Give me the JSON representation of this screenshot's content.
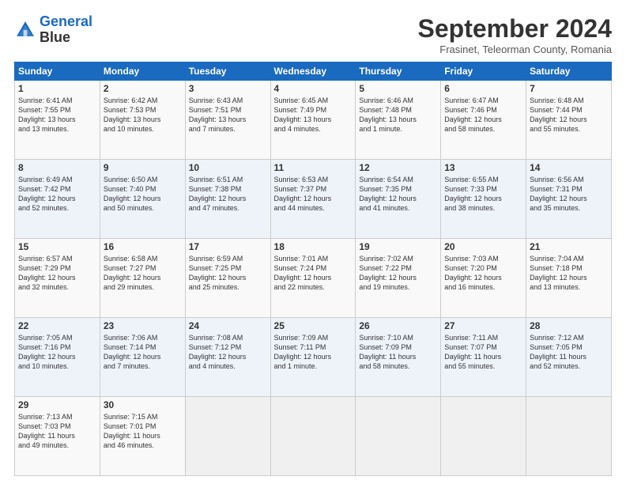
{
  "header": {
    "logo_line1": "General",
    "logo_line2": "Blue",
    "month_title": "September 2024",
    "location": "Frasinet, Teleorman County, Romania"
  },
  "weekdays": [
    "Sunday",
    "Monday",
    "Tuesday",
    "Wednesday",
    "Thursday",
    "Friday",
    "Saturday"
  ],
  "weeks": [
    [
      {
        "day": "1",
        "lines": [
          "Sunrise: 6:41 AM",
          "Sunset: 7:55 PM",
          "Daylight: 13 hours",
          "and 13 minutes."
        ]
      },
      {
        "day": "2",
        "lines": [
          "Sunrise: 6:42 AM",
          "Sunset: 7:53 PM",
          "Daylight: 13 hours",
          "and 10 minutes."
        ]
      },
      {
        "day": "3",
        "lines": [
          "Sunrise: 6:43 AM",
          "Sunset: 7:51 PM",
          "Daylight: 13 hours",
          "and 7 minutes."
        ]
      },
      {
        "day": "4",
        "lines": [
          "Sunrise: 6:45 AM",
          "Sunset: 7:49 PM",
          "Daylight: 13 hours",
          "and 4 minutes."
        ]
      },
      {
        "day": "5",
        "lines": [
          "Sunrise: 6:46 AM",
          "Sunset: 7:48 PM",
          "Daylight: 13 hours",
          "and 1 minute."
        ]
      },
      {
        "day": "6",
        "lines": [
          "Sunrise: 6:47 AM",
          "Sunset: 7:46 PM",
          "Daylight: 12 hours",
          "and 58 minutes."
        ]
      },
      {
        "day": "7",
        "lines": [
          "Sunrise: 6:48 AM",
          "Sunset: 7:44 PM",
          "Daylight: 12 hours",
          "and 55 minutes."
        ]
      }
    ],
    [
      {
        "day": "8",
        "lines": [
          "Sunrise: 6:49 AM",
          "Sunset: 7:42 PM",
          "Daylight: 12 hours",
          "and 52 minutes."
        ]
      },
      {
        "day": "9",
        "lines": [
          "Sunrise: 6:50 AM",
          "Sunset: 7:40 PM",
          "Daylight: 12 hours",
          "and 50 minutes."
        ]
      },
      {
        "day": "10",
        "lines": [
          "Sunrise: 6:51 AM",
          "Sunset: 7:38 PM",
          "Daylight: 12 hours",
          "and 47 minutes."
        ]
      },
      {
        "day": "11",
        "lines": [
          "Sunrise: 6:53 AM",
          "Sunset: 7:37 PM",
          "Daylight: 12 hours",
          "and 44 minutes."
        ]
      },
      {
        "day": "12",
        "lines": [
          "Sunrise: 6:54 AM",
          "Sunset: 7:35 PM",
          "Daylight: 12 hours",
          "and 41 minutes."
        ]
      },
      {
        "day": "13",
        "lines": [
          "Sunrise: 6:55 AM",
          "Sunset: 7:33 PM",
          "Daylight: 12 hours",
          "and 38 minutes."
        ]
      },
      {
        "day": "14",
        "lines": [
          "Sunrise: 6:56 AM",
          "Sunset: 7:31 PM",
          "Daylight: 12 hours",
          "and 35 minutes."
        ]
      }
    ],
    [
      {
        "day": "15",
        "lines": [
          "Sunrise: 6:57 AM",
          "Sunset: 7:29 PM",
          "Daylight: 12 hours",
          "and 32 minutes."
        ]
      },
      {
        "day": "16",
        "lines": [
          "Sunrise: 6:58 AM",
          "Sunset: 7:27 PM",
          "Daylight: 12 hours",
          "and 29 minutes."
        ]
      },
      {
        "day": "17",
        "lines": [
          "Sunrise: 6:59 AM",
          "Sunset: 7:25 PM",
          "Daylight: 12 hours",
          "and 25 minutes."
        ]
      },
      {
        "day": "18",
        "lines": [
          "Sunrise: 7:01 AM",
          "Sunset: 7:24 PM",
          "Daylight: 12 hours",
          "and 22 minutes."
        ]
      },
      {
        "day": "19",
        "lines": [
          "Sunrise: 7:02 AM",
          "Sunset: 7:22 PM",
          "Daylight: 12 hours",
          "and 19 minutes."
        ]
      },
      {
        "day": "20",
        "lines": [
          "Sunrise: 7:03 AM",
          "Sunset: 7:20 PM",
          "Daylight: 12 hours",
          "and 16 minutes."
        ]
      },
      {
        "day": "21",
        "lines": [
          "Sunrise: 7:04 AM",
          "Sunset: 7:18 PM",
          "Daylight: 12 hours",
          "and 13 minutes."
        ]
      }
    ],
    [
      {
        "day": "22",
        "lines": [
          "Sunrise: 7:05 AM",
          "Sunset: 7:16 PM",
          "Daylight: 12 hours",
          "and 10 minutes."
        ]
      },
      {
        "day": "23",
        "lines": [
          "Sunrise: 7:06 AM",
          "Sunset: 7:14 PM",
          "Daylight: 12 hours",
          "and 7 minutes."
        ]
      },
      {
        "day": "24",
        "lines": [
          "Sunrise: 7:08 AM",
          "Sunset: 7:12 PM",
          "Daylight: 12 hours",
          "and 4 minutes."
        ]
      },
      {
        "day": "25",
        "lines": [
          "Sunrise: 7:09 AM",
          "Sunset: 7:11 PM",
          "Daylight: 12 hours",
          "and 1 minute."
        ]
      },
      {
        "day": "26",
        "lines": [
          "Sunrise: 7:10 AM",
          "Sunset: 7:09 PM",
          "Daylight: 11 hours",
          "and 58 minutes."
        ]
      },
      {
        "day": "27",
        "lines": [
          "Sunrise: 7:11 AM",
          "Sunset: 7:07 PM",
          "Daylight: 11 hours",
          "and 55 minutes."
        ]
      },
      {
        "day": "28",
        "lines": [
          "Sunrise: 7:12 AM",
          "Sunset: 7:05 PM",
          "Daylight: 11 hours",
          "and 52 minutes."
        ]
      }
    ],
    [
      {
        "day": "29",
        "lines": [
          "Sunrise: 7:13 AM",
          "Sunset: 7:03 PM",
          "Daylight: 11 hours",
          "and 49 minutes."
        ]
      },
      {
        "day": "30",
        "lines": [
          "Sunrise: 7:15 AM",
          "Sunset: 7:01 PM",
          "Daylight: 11 hours",
          "and 46 minutes."
        ]
      },
      null,
      null,
      null,
      null,
      null
    ]
  ]
}
